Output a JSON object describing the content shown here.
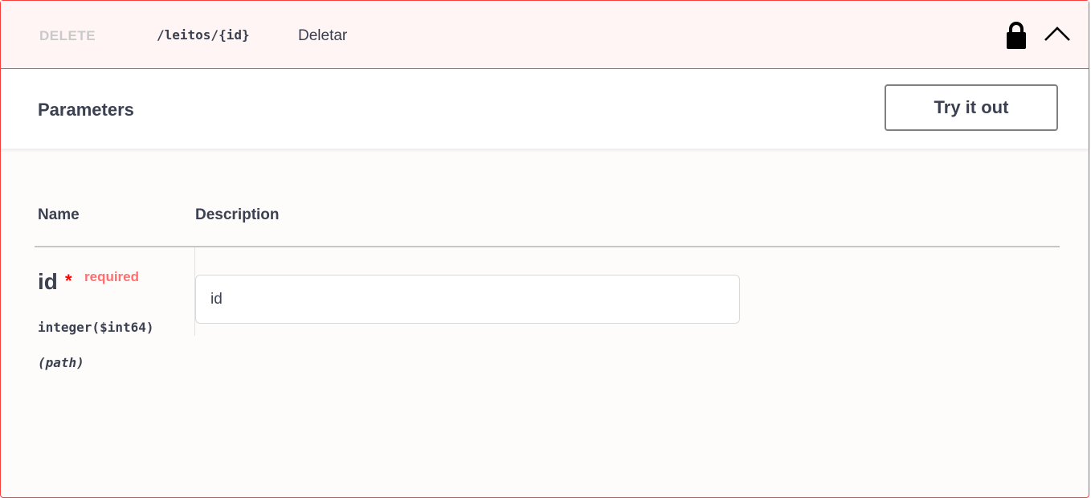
{
  "operation": {
    "method": "DELETE",
    "path": "/leitos/{id}",
    "summary": "Deletar",
    "lock_icon": "lock-icon",
    "collapse_icon": "chevron-up-icon"
  },
  "parameters": {
    "title": "Parameters",
    "try_label": "Try it out",
    "columns": {
      "name": "Name",
      "description": "Description"
    },
    "items": [
      {
        "name": "id",
        "required_star": "*",
        "required_label": "required",
        "type": "integer($int64)",
        "in": "(path)",
        "placeholder": "id"
      }
    ]
  },
  "colors": {
    "delete_accent": "#f93e3e",
    "required": "#ff6f6f",
    "text": "#3b4151"
  }
}
